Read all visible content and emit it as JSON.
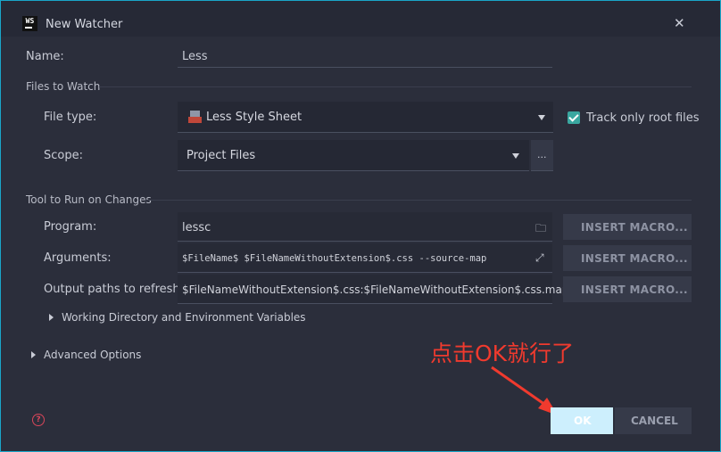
{
  "window": {
    "logo_text": "WS",
    "title": "New Watcher",
    "close_glyph": "✕"
  },
  "name": {
    "label": "Name:",
    "value": "Less"
  },
  "files_to_watch": {
    "section_label": "Files to Watch",
    "file_type_label": "File type:",
    "file_type_value": "Less Style Sheet",
    "scope_label": "Scope:",
    "scope_value": "Project Files",
    "scope_more": "...",
    "track_only_root_label": "Track only root files",
    "track_only_root_checked": true
  },
  "tool": {
    "section_label": "Tool to Run on Changes",
    "program_label": "Program:",
    "program_value": "lessc",
    "arguments_label": "Arguments:",
    "arguments_value": "$FileName$ $FileNameWithoutExtension$.css --source-map",
    "output_label": "Output paths to refresh:",
    "output_value": "$FileNameWithoutExtension$.css:$FileNameWithoutExtension$.css.map",
    "insert_macro_label": "INSERT MACRO...",
    "working_dir_label": "Working Directory and Environment Variables"
  },
  "advanced_label": "Advanced Options",
  "buttons": {
    "help": "?",
    "ok": "OK",
    "cancel": "CANCEL"
  },
  "annotation": {
    "text": "点击OK就行了",
    "color": "#f03a2e"
  },
  "colors": {
    "accent_border": "#1aa6c9",
    "checkbox": "#3aa7a0",
    "ok_button": "#cdeffd"
  }
}
